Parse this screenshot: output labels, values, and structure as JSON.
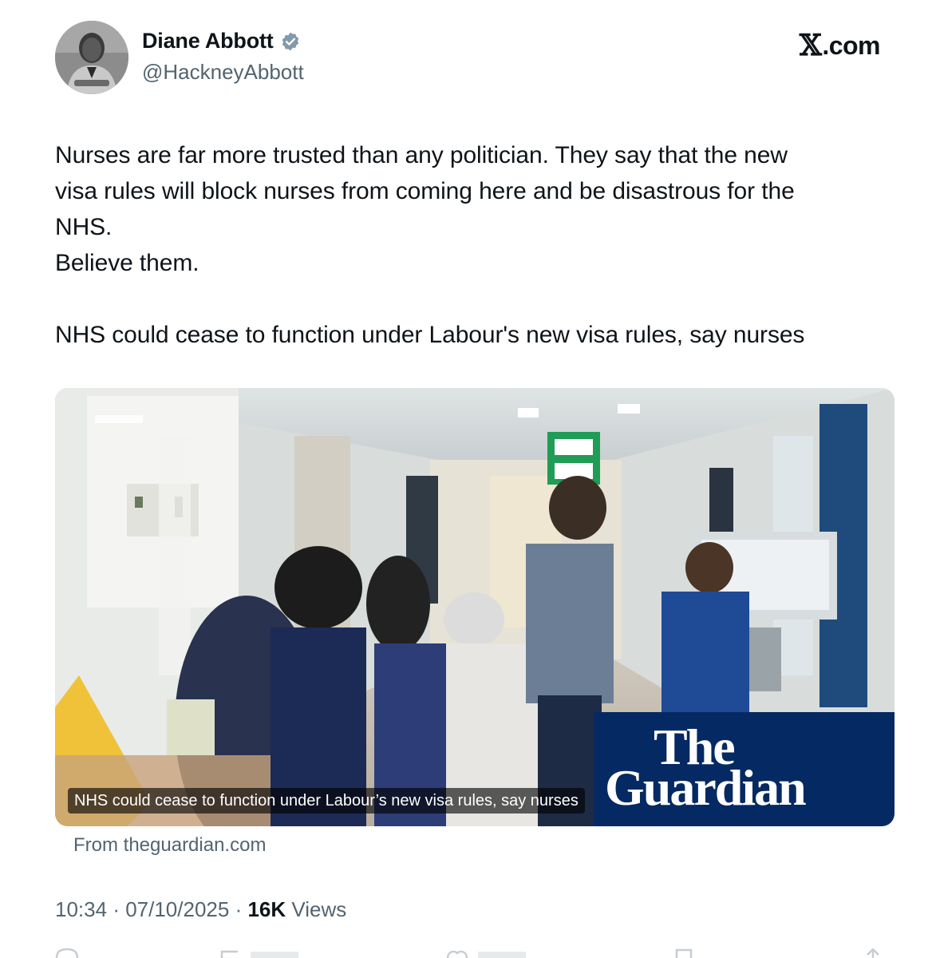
{
  "author": {
    "name": "Diane Abbott",
    "handle": "@HackneyAbbott",
    "verified_icon": "verified-badge-icon"
  },
  "brand": {
    "x_letter": "𝕏",
    "rest": ".com"
  },
  "tweet": {
    "text": "Nurses are far more trusted than any politician. They say that the new\nvisa rules will block nurses from coming here and be disastrous for the\nNHS.\nBelieve them.\n\nNHS could cease to function under Labour's new visa rules, say nurses"
  },
  "card": {
    "caption": "NHS could cease to function under Labour’s new visa rules, say nurses",
    "logo_line1": "The",
    "logo_line2": "Guardian",
    "source": "From theguardian.com"
  },
  "meta": {
    "time": "10:34",
    "date": "07/10/2025",
    "views_count": "16K",
    "views_label": "Views"
  },
  "colors": {
    "text_primary": "#0f1419",
    "text_secondary": "#536471",
    "verified_blue": "#829aab",
    "guardian_blue": "#052962"
  }
}
